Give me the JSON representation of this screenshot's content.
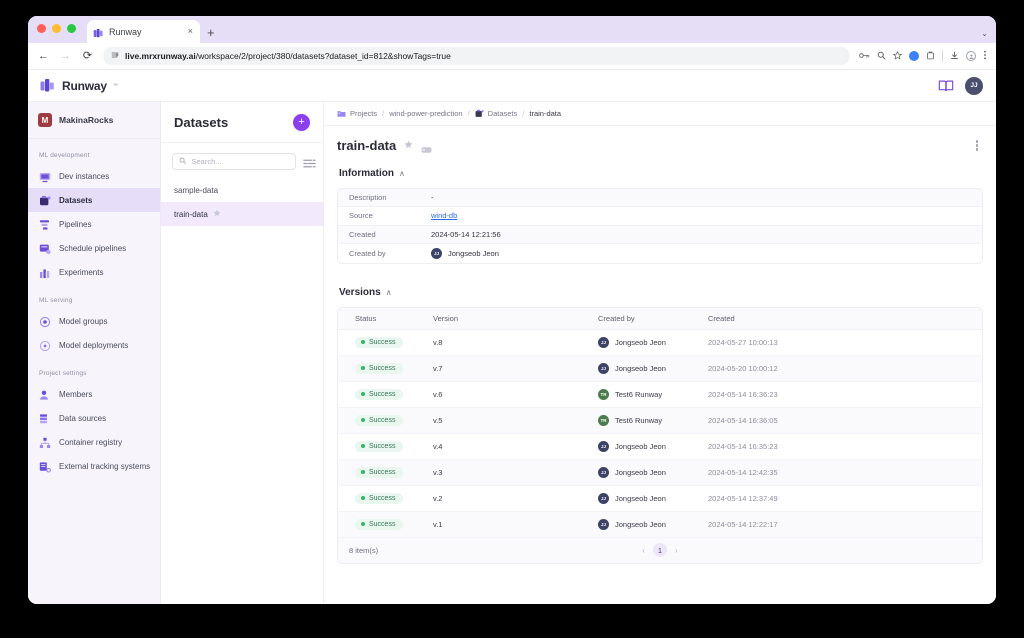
{
  "browser": {
    "tab": {
      "title": "Runway",
      "favicon": "runway-favicon",
      "close": "×"
    },
    "new_tab": "+",
    "tab_list_chevron": "⌄",
    "nav": {
      "back": "←",
      "forward": "→",
      "reload": "⟳"
    },
    "omnibox": {
      "site_icon": "site-settings-icon",
      "url_bold": "live.mrxrunway.ai",
      "url_rest": "/workspace/2/project/380/datasets?dataset_id=812&showTags=true"
    },
    "toolbar_icons": [
      "password-key-icon",
      "zoom-icon",
      "bookmark-star-icon",
      "extension-blue-icon",
      "extension-puzzle-icon",
      "download-icon",
      "profile-icon",
      "menu-kebab-icon"
    ]
  },
  "header": {
    "logo_text": "Runway",
    "logo_tm": "™",
    "docs_icon": "book-icon",
    "avatar_initials": "JJ"
  },
  "sidebar": {
    "workspace": {
      "mark": "M",
      "name": "MakinaRocks"
    },
    "groups": [
      {
        "label": "ML development",
        "items": [
          {
            "label": "Dev instances",
            "icon": "dev-instances-icon",
            "active": false
          },
          {
            "label": "Datasets",
            "icon": "datasets-icon",
            "active": true
          },
          {
            "label": "Pipelines",
            "icon": "pipelines-icon",
            "active": false
          },
          {
            "label": "Schedule pipelines",
            "icon": "schedule-pipelines-icon",
            "active": false
          },
          {
            "label": "Experiments",
            "icon": "experiments-icon",
            "active": false
          }
        ]
      },
      {
        "label": "ML serving",
        "items": [
          {
            "label": "Model groups",
            "icon": "model-groups-icon",
            "active": false
          },
          {
            "label": "Model deployments",
            "icon": "model-deployments-icon",
            "active": false
          }
        ]
      },
      {
        "label": "Project settings",
        "items": [
          {
            "label": "Members",
            "icon": "members-icon",
            "active": false
          },
          {
            "label": "Data sources",
            "icon": "data-sources-icon",
            "active": false
          },
          {
            "label": "Container registry",
            "icon": "container-registry-icon",
            "active": false
          },
          {
            "label": "External tracking systems",
            "icon": "external-tracking-icon",
            "active": false
          }
        ]
      }
    ]
  },
  "list_panel": {
    "title": "Datasets",
    "add_button": "+",
    "search_placeholder": "Search...",
    "search_value": "",
    "filter_icon": "filter-sliders-icon",
    "items": [
      {
        "label": "sample-data",
        "starred": false,
        "selected": false
      },
      {
        "label": "train-data",
        "starred": true,
        "selected": true
      }
    ]
  },
  "breadcrumb": [
    {
      "label": "Projects",
      "icon": "folder-icon"
    },
    {
      "label": "wind-power-prediction",
      "icon": ""
    },
    {
      "label": "Datasets",
      "icon": "datasets-icon"
    },
    {
      "label": "train-data",
      "icon": ""
    }
  ],
  "breadcrumb_separator": "/",
  "page": {
    "title": "train-data",
    "star_icon": "star-icon",
    "tag_icon": "tag-icon",
    "more_icon": "kebab-menu-icon"
  },
  "information": {
    "section_title": "Information",
    "collapse_chevron": "∧",
    "rows": [
      {
        "key": "Description",
        "value": "-",
        "type": "text"
      },
      {
        "key": "Source",
        "value": "wind-db",
        "type": "link"
      },
      {
        "key": "Created",
        "value": "2024-05-14 12:21:56",
        "type": "text"
      },
      {
        "key": "Created by",
        "value": "Jongseob Jeon",
        "type": "user",
        "initials": "JJ",
        "avatar_color": "#3d4366"
      }
    ]
  },
  "versions": {
    "section_title": "Versions",
    "collapse_chevron": "∧",
    "columns": [
      "Status",
      "Version",
      "Created by",
      "Created"
    ],
    "rows": [
      {
        "status": "Success",
        "version": "v.8",
        "created_by": "Jongseob Jeon",
        "initials": "JJ",
        "avatar_color": "#3d4366",
        "created": "2024-05-27 10:00:13"
      },
      {
        "status": "Success",
        "version": "v.7",
        "created_by": "Jongseob Jeon",
        "initials": "JJ",
        "avatar_color": "#3d4366",
        "created": "2024-05-20 10:00:12"
      },
      {
        "status": "Success",
        "version": "v.6",
        "created_by": "Test6 Runway",
        "initials": "TR",
        "avatar_color": "#4c7c4c",
        "created": "2024-05-14 16:36:23"
      },
      {
        "status": "Success",
        "version": "v.5",
        "created_by": "Test6 Runway",
        "initials": "TR",
        "avatar_color": "#4c7c4c",
        "created": "2024-05-14 16:36:05"
      },
      {
        "status": "Success",
        "version": "v.4",
        "created_by": "Jongseob Jeon",
        "initials": "JJ",
        "avatar_color": "#3d4366",
        "created": "2024-05-14 16:35:23"
      },
      {
        "status": "Success",
        "version": "v.3",
        "created_by": "Jongseob Jeon",
        "initials": "JJ",
        "avatar_color": "#3d4366",
        "created": "2024-05-14 12:42:35"
      },
      {
        "status": "Success",
        "version": "v.2",
        "created_by": "Jongseob Jeon",
        "initials": "JJ",
        "avatar_color": "#3d4366",
        "created": "2024-05-14 12:37:49"
      },
      {
        "status": "Success",
        "version": "v.1",
        "created_by": "Jongseob Jeon",
        "initials": "JJ",
        "avatar_color": "#3d4366",
        "created": "2024-05-14 12:22:17"
      }
    ],
    "footer_count": "8 item(s)",
    "pagination": {
      "prev": "‹",
      "current": "1",
      "next": "›"
    }
  },
  "colors": {
    "brand_purple": "#8b3ff0",
    "sidebar_bg": "#f7f5fb",
    "active_nav": "#e6ddf8",
    "success_green": "#37b26a",
    "success_bg": "#e9f7ee",
    "link_blue": "#2d6fe0",
    "tabstrip_purple": "#e6ddf6"
  }
}
